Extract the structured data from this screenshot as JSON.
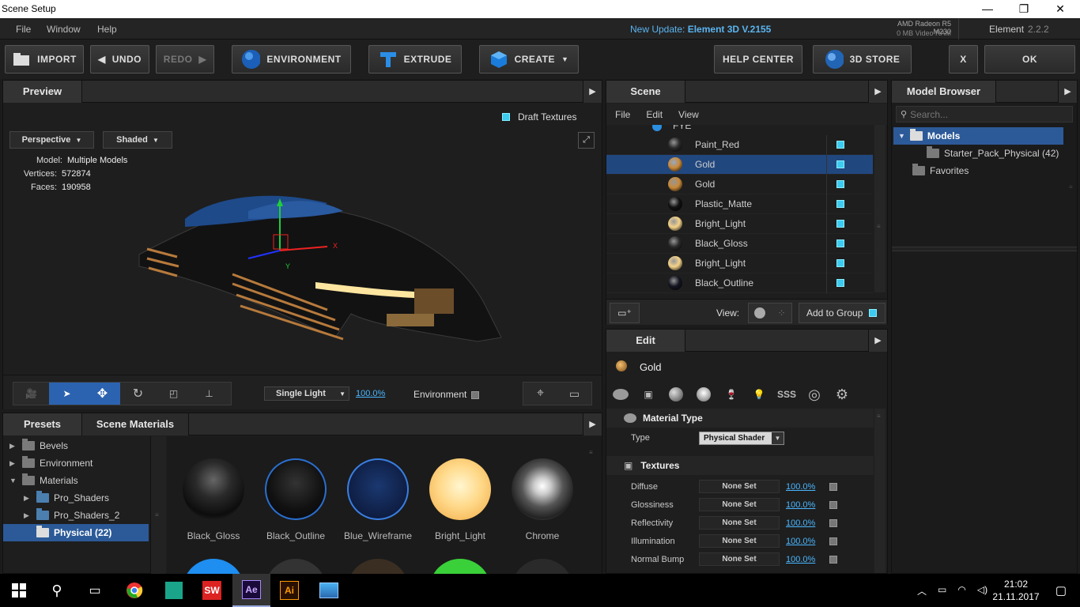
{
  "window": {
    "title": "Scene Setup",
    "restore_icon": "restore-icon",
    "close_icon": "close-icon"
  },
  "menu": {
    "items": [
      "File",
      "Window",
      "Help"
    ],
    "update_prefix": "New Update:",
    "update_version": "Element 3D V.2155",
    "gpu_name": "AMD Radeon R5 M230",
    "gpu_ram": "0 MB Video RAM",
    "app_name": "Element",
    "app_version": "2.2.2"
  },
  "toolbar": {
    "import": "IMPORT",
    "undo": "UNDO",
    "redo": "REDO",
    "environment": "ENVIRONMENT",
    "extrude": "EXTRUDE",
    "create": "CREATE",
    "help_center": "HELP CENTER",
    "store": "3D STORE",
    "close": "X",
    "ok": "OK"
  },
  "preview": {
    "tab": "Preview",
    "draft_textures": "Draft Textures",
    "camera": "Perspective",
    "shading": "Shaded",
    "stats": [
      {
        "k": "Model:",
        "v": "Multiple Models"
      },
      {
        "k": "Vertices:",
        "v": "572874"
      },
      {
        "k": "Faces:",
        "v": "190958"
      }
    ],
    "axis_y": "Y",
    "axis_x": "X",
    "light_mode": "Single Light",
    "light_pct": "100.0%",
    "environment": "Environment"
  },
  "scene": {
    "tab": "Scene",
    "menu": [
      "File",
      "Edit",
      "View"
    ],
    "group_label": "FYE",
    "rows": [
      {
        "label": "Paint_Red",
        "ball": "#2a2a2a"
      },
      {
        "label": "Gold",
        "ball": "#c98a3a",
        "selected": true
      },
      {
        "label": "Gold",
        "ball": "#c98a3a"
      },
      {
        "label": "Plastic_Matte",
        "ball": "#111"
      },
      {
        "label": "Bright_Light",
        "ball": "#f4d28a"
      },
      {
        "label": "Black_Gloss",
        "ball": "#2a2a2a"
      },
      {
        "label": "Bright_Light",
        "ball": "#f4d28a"
      },
      {
        "label": "Black_Outline",
        "ball": "#151522"
      }
    ],
    "view_label": "View:",
    "add_to_group": "Add to Group"
  },
  "model_browser": {
    "tab": "Model Browser",
    "search_placeholder": "Search...",
    "tree": [
      {
        "label": "Models"
      },
      {
        "label": "Starter_Pack_Physical (42)"
      },
      {
        "label": "Favorites"
      }
    ]
  },
  "presets": {
    "tabs": [
      "Presets",
      "Scene Materials"
    ],
    "tree": [
      {
        "label": "Bevels",
        "arrow": "▶",
        "indent": 0
      },
      {
        "label": "Environment",
        "arrow": "▶",
        "indent": 0
      },
      {
        "label": "Materials",
        "arrow": "▼",
        "indent": 0
      },
      {
        "label": "Pro_Shaders",
        "arrow": "▶",
        "indent": 1
      },
      {
        "label": "Pro_Shaders_2",
        "arrow": "▶",
        "indent": 1
      },
      {
        "label": "Physical (22)",
        "arrow": "",
        "indent": 1,
        "selected": true
      }
    ],
    "materials": [
      "Black_Gloss",
      "Black_Outline",
      "Blue_Wireframe",
      "Bright_Light",
      "Chrome"
    ]
  },
  "edit": {
    "tab": "Edit",
    "material_name": "Gold",
    "material_type_label": "Material Type",
    "type_label": "Type",
    "type_value": "Physical Shader",
    "textures_label": "Textures",
    "textures": [
      {
        "name": "Diffuse",
        "value": "None Set",
        "pct": "100.0%"
      },
      {
        "name": "Glossiness",
        "value": "None Set",
        "pct": "100.0%"
      },
      {
        "name": "Reflectivity",
        "value": "None Set",
        "pct": "100.0%"
      },
      {
        "name": "Illumination",
        "value": "None Set",
        "pct": "100.0%"
      },
      {
        "name": "Normal Bump",
        "value": "None Set",
        "pct": "100.0%"
      }
    ],
    "sss_label": "SSS"
  },
  "taskbar": {
    "time": "21:02",
    "date": "21.11.2017",
    "sw": "SW",
    "ae": "Ae",
    "ai": "Ai"
  }
}
